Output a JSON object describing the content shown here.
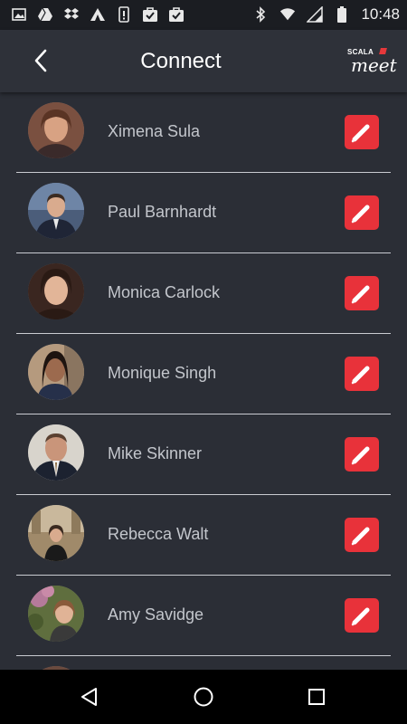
{
  "status_bar": {
    "time": "10:48",
    "left_icons": [
      "image-icon",
      "drive-icon",
      "dropbox-icon",
      "camp-icon",
      "phone-alert-icon",
      "bag-check-icon",
      "bag-check-icon"
    ],
    "right_icons": [
      "bluetooth-icon",
      "wifi-icon",
      "signal-icon",
      "battery-icon"
    ]
  },
  "header": {
    "title": "Connect",
    "logo_small": "SCALA",
    "logo_main": "meet"
  },
  "contacts": [
    {
      "name": "Ximena Sula",
      "avatar_color": "#c98a6a"
    },
    {
      "name": "Paul Barnhardt",
      "avatar_color": "#2f3b55"
    },
    {
      "name": "Monica Carlock",
      "avatar_color": "#4a3028"
    },
    {
      "name": "Monique Singh",
      "avatar_color": "#5a4a3c"
    },
    {
      "name": "Mike Skinner",
      "avatar_color": "#8a6b58"
    },
    {
      "name": "Rebecca Walt",
      "avatar_color": "#8f7a62"
    },
    {
      "name": "Amy Savidge",
      "avatar_color": "#6b7a4a"
    },
    {
      "name": "",
      "avatar_color": "#7a4a3c"
    }
  ],
  "colors": {
    "accent": "#e8323a",
    "background": "#2b2e36",
    "text": "#c3c6cc"
  }
}
